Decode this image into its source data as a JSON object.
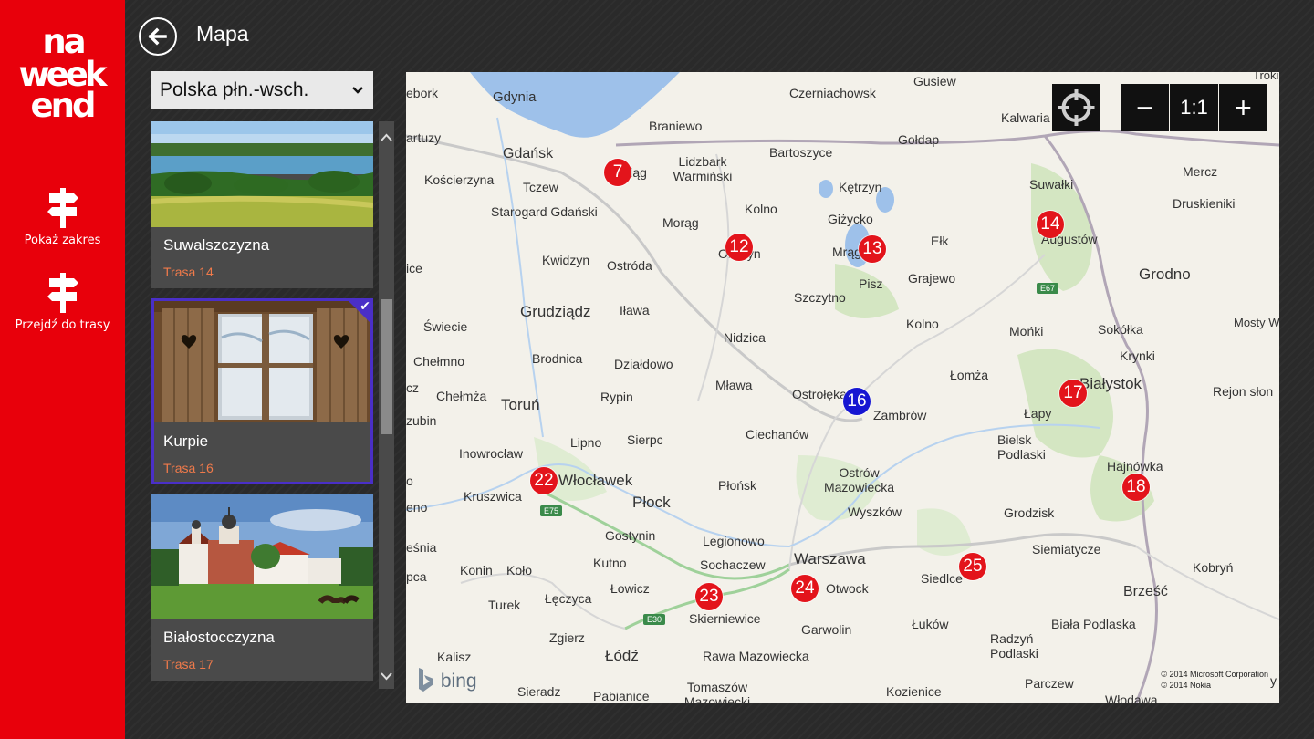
{
  "app": {
    "logo_text": "na week end"
  },
  "sidebar": {
    "items": [
      {
        "label": "Pokaż zakres",
        "icon": "signpost-icon"
      },
      {
        "label": "Przejdź do trasy",
        "icon": "signpost-icon"
      }
    ]
  },
  "header": {
    "title": "Mapa"
  },
  "region": {
    "selected": "Polska płn.-wsch."
  },
  "routes": [
    {
      "name": "Suwalszczyzna",
      "route": "Trasa 14",
      "selected": false
    },
    {
      "name": "Kurpie",
      "route": "Trasa 16",
      "selected": true
    },
    {
      "name": "Białostocczyzna",
      "route": "Trasa 17",
      "selected": false
    }
  ],
  "map": {
    "controls": {
      "locate_icon": "crosshair-icon",
      "zoom_out": "−",
      "zoom_reset": "1:1",
      "zoom_in": "+"
    },
    "provider": "bing",
    "copyright": [
      "© 2014 Microsoft Corporation",
      "© 2014 Nokia"
    ],
    "road_badges": [
      "E67",
      "E75",
      "E30"
    ],
    "cities": [
      "Gdynia",
      "Czerniachowsk",
      "Gusiew",
      "Troki",
      "ebork",
      "Kalwaria",
      "Braniewo",
      "artuzy",
      "Gdańsk",
      "Lidzbark Warmiński",
      "Bartoszyce",
      "Gołdap",
      "Mercz",
      "Kościerzyna",
      "Tczew",
      "Suwałki",
      "Druskieniki",
      "Kętrzyn",
      "Starogard Gdański",
      "Morąg",
      "Kolno",
      "Giżycko",
      "Ełk",
      "Augustów",
      "ice",
      "Kwidzyn",
      "Ostróda",
      "Grajewo",
      "Pisz",
      "Szczytno",
      "Grodno",
      "Grudziądz",
      "Iława",
      "Świecie",
      "Kolno",
      "Mońki",
      "Sokółka",
      "Mosty W",
      "Brodnica",
      "Nidzica",
      "Chełmno",
      "Działdowo",
      "Krynki",
      "cz",
      "Chełmża",
      "Mława",
      "Łomża",
      "Białystok",
      "Rypin",
      "Toruń",
      "Ostrołęka",
      "Rejon słon",
      "Łapy",
      "zubin",
      "Zambrów",
      "Lipno",
      "Sierpc",
      "Ciechanów",
      "Bielsk Podlaski",
      "Inowrocław",
      "Włocławek",
      "Hajnówka",
      "o",
      "Płońsk",
      "Ostrów Mazowiecka",
      "Kruszwica",
      "Płock",
      "eno",
      "Wyszków",
      "Grodzisk",
      "Gostynin",
      "Legionowo",
      "eśnia",
      "Siemiatycze",
      "Warszawa",
      "Kutno",
      "Sochaczew",
      "Kobryń",
      "pca",
      "Konin",
      "Koło",
      "Siedlce",
      "Łowicz",
      "Otwock",
      "Łęczyca",
      "Brześć",
      "Turek",
      "Skierniewice",
      "Łuków",
      "Biała Podlaska",
      "Garwolin",
      "Zgierz",
      "Radzyń Podlaski",
      "Kalisz",
      "Łódź",
      "Rawa Mazowiecka",
      "Tomaszów Mazowiecki",
      "Parczew",
      "Sieradz",
      "Pabianice",
      "Kozienice",
      "Włodawa",
      "y",
      "Mrągowo",
      "Elbląg",
      "Olsztyn"
    ],
    "pins": [
      {
        "id": "7",
        "active": false
      },
      {
        "id": "12",
        "active": false
      },
      {
        "id": "13",
        "active": false
      },
      {
        "id": "14",
        "active": false
      },
      {
        "id": "16",
        "active": true
      },
      {
        "id": "17",
        "active": false
      },
      {
        "id": "18",
        "active": false
      },
      {
        "id": "22",
        "active": false
      },
      {
        "id": "23",
        "active": false
      },
      {
        "id": "24",
        "active": false
      },
      {
        "id": "25",
        "active": false
      }
    ]
  },
  "colors": {
    "brand_red": "#e8000b",
    "selection_purple": "#4a2fc7",
    "route_orange": "#f07a4a",
    "pin_red": "#e3141b",
    "pin_active_blue": "#1616d2"
  }
}
